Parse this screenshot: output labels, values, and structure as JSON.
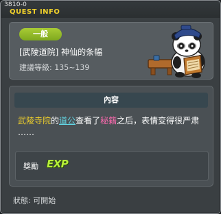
{
  "window": {
    "quest_id": "3810-0",
    "title": "QUEST INFO"
  },
  "header": {
    "category": "一般",
    "quest_name": "[武陵道院] 神仙的条幅",
    "level_requirement": "建議等級: 135~139",
    "npc_icon": "panda-npc-reading-icon"
  },
  "content": {
    "heading": "內容",
    "description": {
      "part1": "武陵寺院",
      "part2": "的",
      "part3": "道公",
      "part4": "查看了",
      "part5": "秘籍",
      "part6": "之后，表情变得很严肃",
      "part7": "……"
    },
    "reward_label": "獎勵",
    "reward_icon_text": "EXP"
  },
  "status": "狀態: 可開始",
  "colors": {
    "title": "#f2d22b",
    "badge": "#96be2a",
    "place_highlight": "#f2d22b",
    "npc_highlight": "#63d7e6",
    "item_highlight": "#ff6ab0",
    "exp": "#b8f03a"
  }
}
